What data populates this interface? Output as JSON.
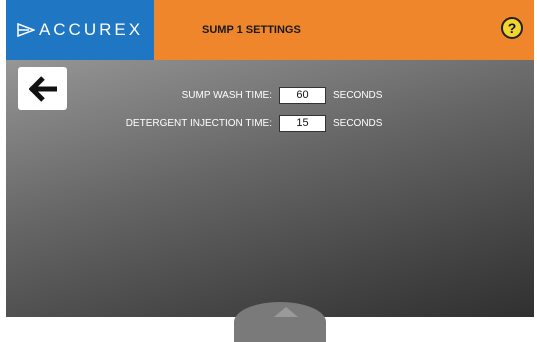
{
  "header": {
    "logo_text": "ACCUREX",
    "title": "SUMP 1 SETTINGS",
    "help_glyph": "?"
  },
  "icons": {
    "logo": "accurex-arrow-logo-icon",
    "help": "help-question-icon",
    "back": "back-arrow-icon",
    "bottom": "scroll-up-knob-icon"
  },
  "colors": {
    "logo_bg": "#1f76c2",
    "title_bg": "#f0862b",
    "help_bg": "#f2d530"
  },
  "settings": [
    {
      "label": "SUMP WASH TIME:",
      "value": "60",
      "unit": "SECONDS"
    },
    {
      "label": "DETERGENT INJECTION TIME:",
      "value": "15",
      "unit": "SECONDS"
    }
  ]
}
